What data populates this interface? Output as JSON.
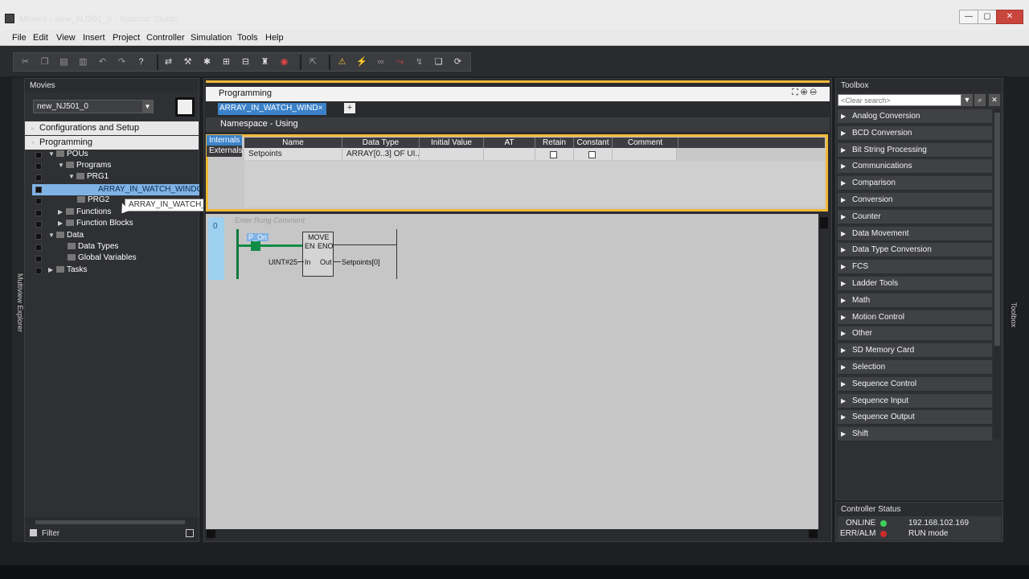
{
  "window": {
    "title": "Movies - new_NJ501_0 - Sysmac Studio",
    "minimize": "—",
    "maximize": "▢",
    "close": "✕"
  },
  "menu": [
    "File",
    "Edit",
    "View",
    "Insert",
    "Project",
    "Controller",
    "Simulation",
    "Tools",
    "Help"
  ],
  "explorer": {
    "header": "Movies",
    "controller": "new_NJ501_0",
    "side_label": "Multiview Explorer",
    "sections": {
      "config": "Configurations and Setup",
      "programming": "Programming"
    },
    "tree": {
      "pous": "POUs",
      "programs": "Programs",
      "prg1": "PRG1",
      "section": "ARRAY_IN_WATCH_WINDOW",
      "prg2": "PRG2",
      "functions": "Functions",
      "function_blocks": "Function Blocks",
      "data": "Data",
      "data_types": "Data Types",
      "global_variables": "Global Variables",
      "tasks": "Tasks"
    },
    "tooltip": "ARRAY_IN_WATCH_WINDOW",
    "filter": "Filter"
  },
  "programming": {
    "header": "Programming",
    "tab": "ARRAY_IN_WATCH_WIND×",
    "add_tab": "+",
    "namespace": "Namespace - Using",
    "var_tabs": {
      "internals": "Internals",
      "externals": "Externals"
    },
    "columns": [
      "Name",
      "Data Type",
      "Initial Value",
      "AT",
      "Retain",
      "Constant",
      "Comment"
    ],
    "rows": [
      {
        "name": "Setpoints",
        "data_type": "ARRAY[0..3] OF UI...",
        "initial": "",
        "at": "",
        "retain": false,
        "constant": false,
        "comment": ""
      }
    ]
  },
  "ladder": {
    "rung_number": "0",
    "rung_comment": "Enter Rung Comment",
    "contact": "P_On",
    "block": "MOVE",
    "en": "EN",
    "eno": "ENO",
    "in_pin": "In",
    "out_pin": "Out",
    "in_value": "UINT#25",
    "out_value": "Setpoints[0]"
  },
  "toolbox": {
    "header": "Toolbox",
    "search_placeholder": "<Clear search>",
    "side_label": "Toolbox",
    "categories": [
      "Analog Conversion",
      "BCD Conversion",
      "Bit String Processing",
      "Communications",
      "Comparison",
      "Conversion",
      "Counter",
      "Data Movement",
      "Data Type Conversion",
      "FCS",
      "Ladder Tools",
      "Math",
      "Motion Control",
      "Other",
      "SD Memory Card",
      "Selection",
      "Sequence Control",
      "Sequence Input",
      "Sequence Output",
      "Shift"
    ]
  },
  "status": {
    "header": "Controller Status",
    "online_label": "ONLINE",
    "ip": "192.168.102.169",
    "err_label": "ERR/ALM",
    "mode": "RUN mode",
    "online_color": "#3fcf5c",
    "err_color": "#d02a2a"
  }
}
